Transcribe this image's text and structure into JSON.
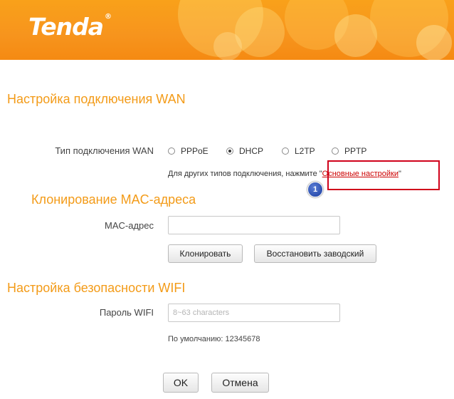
{
  "header": {
    "logo": "Tenda",
    "logo_mark": "®",
    "brand_color": "#f7941d"
  },
  "wan": {
    "title": "Настройка подключения WAN",
    "type_label": "Тип подключения WAN",
    "options": [
      {
        "label": "PPPoE",
        "checked": false
      },
      {
        "label": "DHCP",
        "checked": true
      },
      {
        "label": "L2TP",
        "checked": false
      },
      {
        "label": "PPTP",
        "checked": false
      }
    ],
    "hint_prefix": "Для других типов подключения, нажмите \"",
    "hint_link": "Основные настройки",
    "hint_suffix": "\"",
    "badge": "1"
  },
  "mac": {
    "title": "Клонирование MAC-адреса",
    "field_label": "MAC-адрес",
    "value": "",
    "clone_button": "Клонировать",
    "restore_button": "Восстановить заводский"
  },
  "wifi": {
    "title": "Настройка безопасности WIFI",
    "password_label": "Пароль WIFI",
    "password_placeholder": "8~63 characters",
    "default_text": "По умолчанию: 12345678"
  },
  "footer": {
    "ok_button": "OK",
    "cancel_button": "Отмена"
  }
}
